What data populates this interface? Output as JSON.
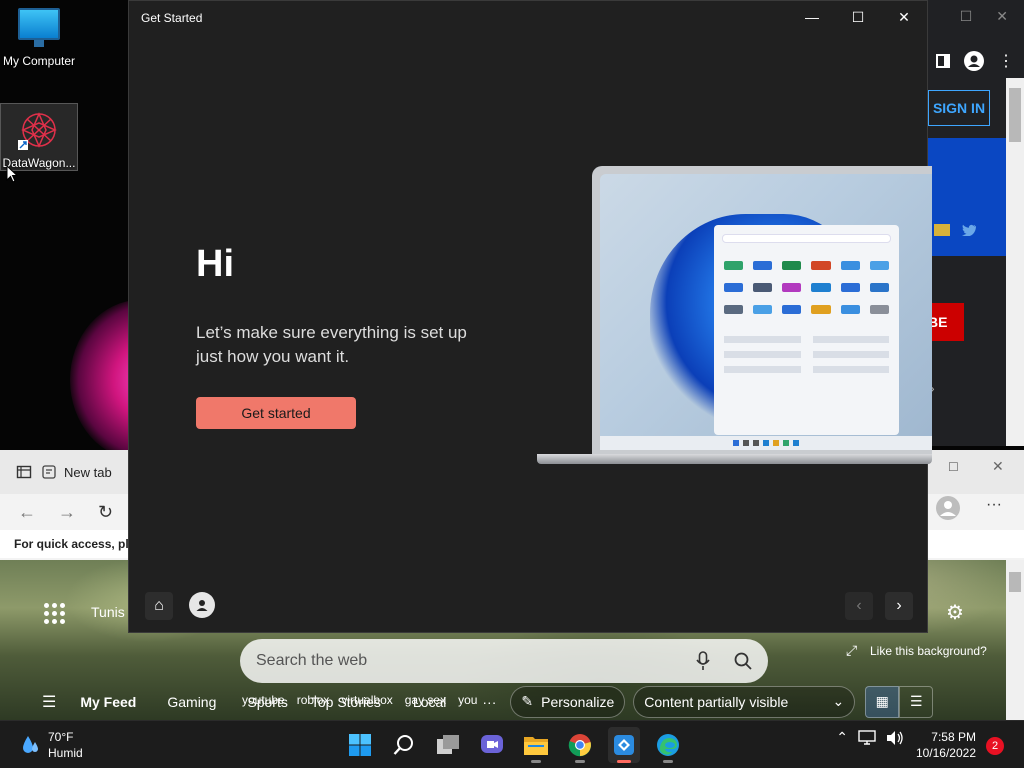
{
  "desktop": {
    "icons": [
      {
        "label": "My Computer",
        "icon": "monitor-icon"
      },
      {
        "label": "DataWagon...",
        "icon": "datawagon-icon"
      }
    ]
  },
  "get_started": {
    "window_title": "Get Started",
    "heading": "Hi",
    "subtitle": "Let’s make sure everything is set up just how you want it.",
    "cta_label": "Get started",
    "cta_color": "#f0786a"
  },
  "bg_browser_top": {
    "signin_label": "SIGN IN",
    "subscribe_fragment": "BE"
  },
  "edge": {
    "tab_label": "New tab",
    "favorites_hint": "For quick access, plac",
    "location": "Tunis",
    "search_placeholder": "Search the web",
    "background_prompt": "Like this background?",
    "feed_items": [
      "My Feed",
      "Gaming",
      "Sports",
      "Top Stories",
      "Local"
    ],
    "quick_links": [
      "youtube",
      "roblox",
      "virtualbox",
      "gay sex",
      "you"
    ],
    "more_label": "···",
    "personalize_label": "Personalize",
    "content_mode": "Content partially visible"
  },
  "taskbar": {
    "temperature": "70°F",
    "condition": "Humid",
    "time": "7:58 PM",
    "date": "10/16/2022",
    "notification_count": "2"
  }
}
